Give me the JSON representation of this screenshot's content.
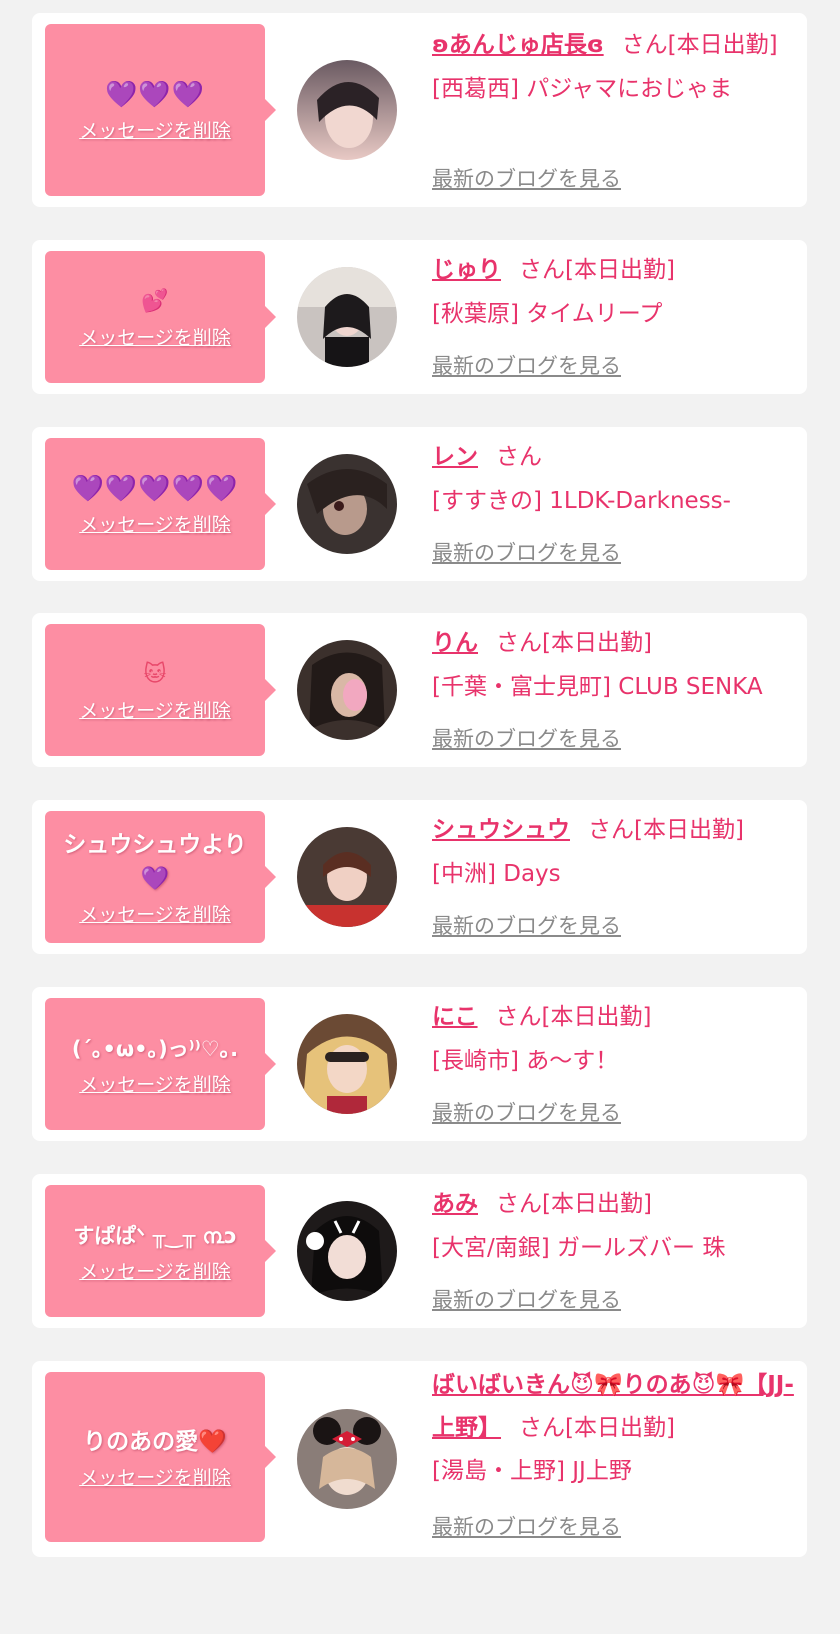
{
  "colors": {
    "page_bg": "#f2f2f2",
    "card_bg": "#ffffff",
    "bubble_bg": "#fd8ea3",
    "accent_text": "#e8336b",
    "link_gray": "#8a8a8a"
  },
  "labels": {
    "delete_message": "メッセージを削除",
    "view_latest_blog": "最新のブログを見る"
  },
  "messages": [
    {
      "message": "💜💜💜",
      "cast_name": "ʚあんじゅ店長ɞ",
      "suffix": "さん[本日出勤]",
      "shop": "[西葛西] パジャマにおじゃま",
      "avatar_icon": "avatar-photo"
    },
    {
      "message": "💕",
      "cast_name": "じゅり",
      "suffix": "さん[本日出勤]",
      "shop": "[秋葉原] タイムリープ",
      "avatar_icon": "avatar-photo"
    },
    {
      "message": "💜💜💜💜💜",
      "cast_name": "レン",
      "suffix": "さん",
      "shop": "[すすきの] 1LDK-Darkness-",
      "avatar_icon": "avatar-photo"
    },
    {
      "message": "🐱",
      "cast_name": "りん",
      "suffix": "さん[本日出勤]",
      "shop": "[千葉・富士見町] CLUB SENKA",
      "avatar_icon": "avatar-photo"
    },
    {
      "message": "シュウシュウより💜",
      "cast_name": "シュウシュウ",
      "suffix": "さん[本日出勤]",
      "shop": "[中洲] Days",
      "avatar_icon": "avatar-photo"
    },
    {
      "message": "(´｡•ω•｡)っ⁾⁾♡｡.",
      "cast_name": "にこ",
      "suffix": "さん[本日出勤]",
      "shop": "[長崎市] あ〜す！",
      "avatar_icon": "avatar-photo"
    },
    {
      "message": "すぱぱᐠ ╥‿╥ ൩ɔ",
      "cast_name": "あみ",
      "suffix": "さん[本日出勤]",
      "shop": "[大宮/南銀] ガールズバー 珠",
      "avatar_icon": "avatar-photo"
    },
    {
      "message": "りのあの愛❤️",
      "cast_name": "ばいばいきん😈🎀りのあ😈🎀【JJ-上野】",
      "suffix": "さん[本日出勤]",
      "shop": "[湯島・上野] JJ上野",
      "avatar_icon": "avatar-photo"
    }
  ]
}
